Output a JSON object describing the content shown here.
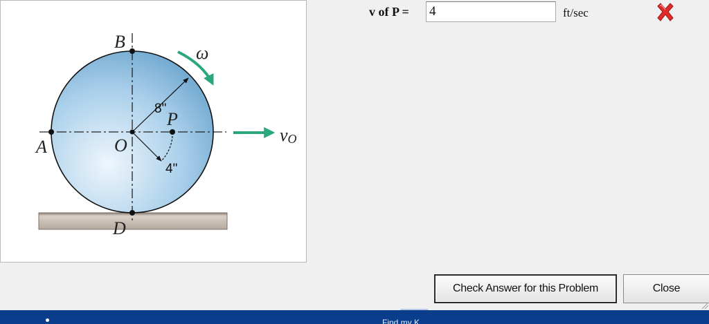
{
  "figure": {
    "labels": {
      "a": "A",
      "b": "B",
      "d": "D",
      "o": "O",
      "p": "P",
      "omega": "ω",
      "vo_main": "v",
      "vo_sub": "O",
      "dim_outer": "8\"",
      "dim_inner": "4\""
    },
    "colors": {
      "disk_light": "#e6f1f9",
      "disk_dark": "#6fa9d2",
      "arrow": "#2aa77f",
      "ground": "#bdb3a9"
    }
  },
  "question": {
    "label": "v of P =",
    "value": "4",
    "unit": "ft/sec",
    "status_icon": "red-x-incorrect-icon",
    "status_color": "#e02b2b"
  },
  "buttons": {
    "check_label": "Check Answer for this Problem",
    "close_label": "Close"
  },
  "taskbar": {
    "text": "Find my K"
  }
}
